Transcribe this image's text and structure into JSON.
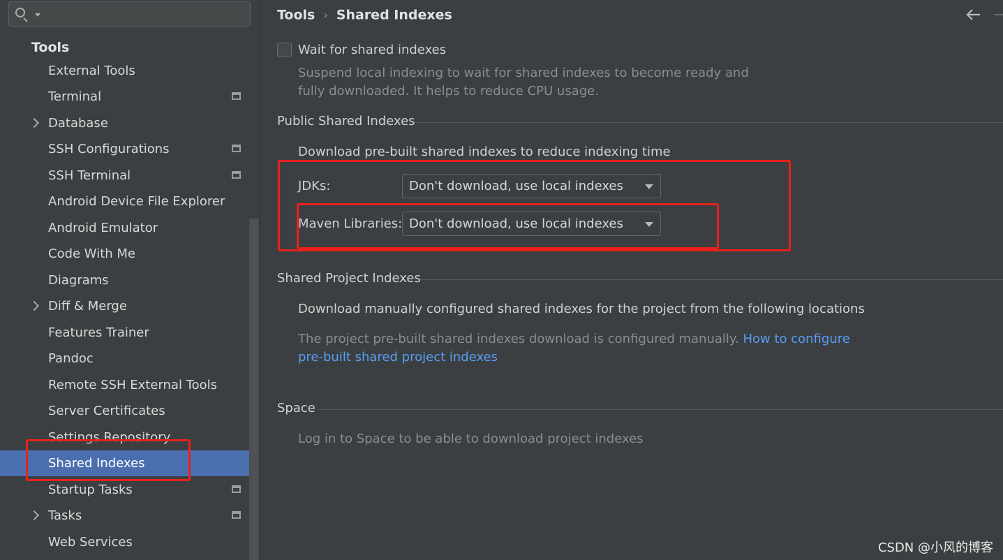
{
  "sidebar": {
    "heading": "Tools",
    "items": [
      {
        "label": "External Tools"
      },
      {
        "label": "Terminal"
      },
      {
        "label": "Database"
      },
      {
        "label": "SSH Configurations"
      },
      {
        "label": "SSH Terminal"
      },
      {
        "label": "Android Device File Explorer"
      },
      {
        "label": "Android Emulator"
      },
      {
        "label": "Code With Me"
      },
      {
        "label": "Diagrams"
      },
      {
        "label": "Diff & Merge"
      },
      {
        "label": "Features Trainer"
      },
      {
        "label": "Pandoc"
      },
      {
        "label": "Remote SSH External Tools"
      },
      {
        "label": "Server Certificates"
      },
      {
        "label": "Settings Repository"
      },
      {
        "label": "Shared Indexes",
        "selected": true
      },
      {
        "label": "Startup Tasks"
      },
      {
        "label": "Tasks"
      },
      {
        "label": "Web Services"
      }
    ]
  },
  "breadcrumb": {
    "parent": "Tools",
    "separator": "›",
    "current": "Shared Indexes"
  },
  "main": {
    "wait_checkbox": {
      "label": "Wait for shared indexes",
      "checked": false,
      "description_line1": "Suspend local indexing to wait for shared indexes to become ready and",
      "description_line2": "fully downloaded. It helps to reduce CPU usage."
    },
    "public_section": {
      "title": "Public Shared Indexes",
      "description": "Download pre-built shared indexes to reduce indexing time",
      "jdks_label": "JDKs:",
      "jdks_value": "Don't download, use local indexes",
      "maven_label": "Maven Libraries:",
      "maven_value": "Don't download, use local indexes"
    },
    "project_section": {
      "title": "Shared Project Indexes",
      "description": "Download manually configured shared indexes for the project from the following locations",
      "note": "The project pre-built shared indexes download is configured manually.",
      "link_line1": "How to configure",
      "link_line2": "pre-built shared project indexes"
    },
    "space_section": {
      "title": "Space",
      "description": "Log in to Space to be able to download project indexes"
    }
  },
  "watermark": "CSDN @小风的博客",
  "colors": {
    "background": "#3c3f41",
    "selection": "#4b6eaf",
    "link": "#589df6",
    "annotation_red": "#e8211b"
  }
}
